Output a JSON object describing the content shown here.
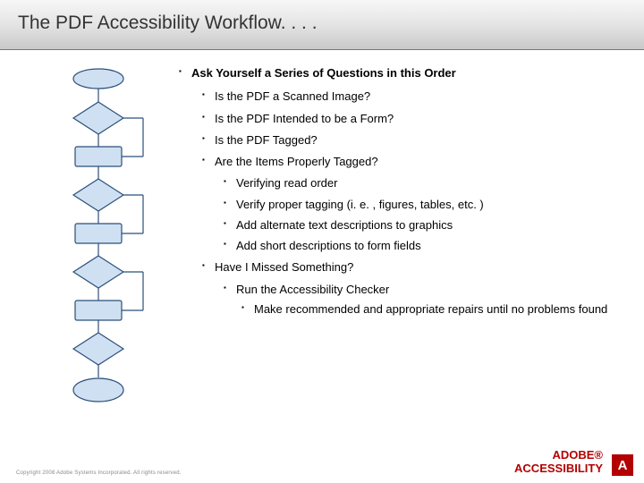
{
  "title": "The PDF Accessibility Workflow. . . .",
  "heading": "Ask Yourself a Series of Questions in this Order",
  "questions": {
    "q1": "Is the PDF a Scanned Image?",
    "q2": "Is the PDF Intended to be a Form?",
    "q3": "Is the PDF Tagged?",
    "q4": "Are the Items Properly Tagged?",
    "sub": {
      "s1": "Verifying read order",
      "s2": "Verify proper tagging (i. e. , figures, tables, etc. )",
      "s3": "Add alternate text descriptions to graphics",
      "s4": "Add short descriptions to form fields"
    },
    "q5": "Have I Missed Something?",
    "q5sub": "Run the Accessibility Checker",
    "q5subsub": "Make recommended and appropriate repairs until no problems found"
  },
  "footer": {
    "copyright": "Copyright 2008 Adobe Systems Incorporated.  All rights reserved.",
    "brand1": "ADOBE®",
    "brand2": "ACCESSIBILITY",
    "logo_letter": "A"
  },
  "colors": {
    "brand_red": "#b30000",
    "flow_blue": "#7aa7d8",
    "flow_stroke": "#2b4f7a"
  }
}
